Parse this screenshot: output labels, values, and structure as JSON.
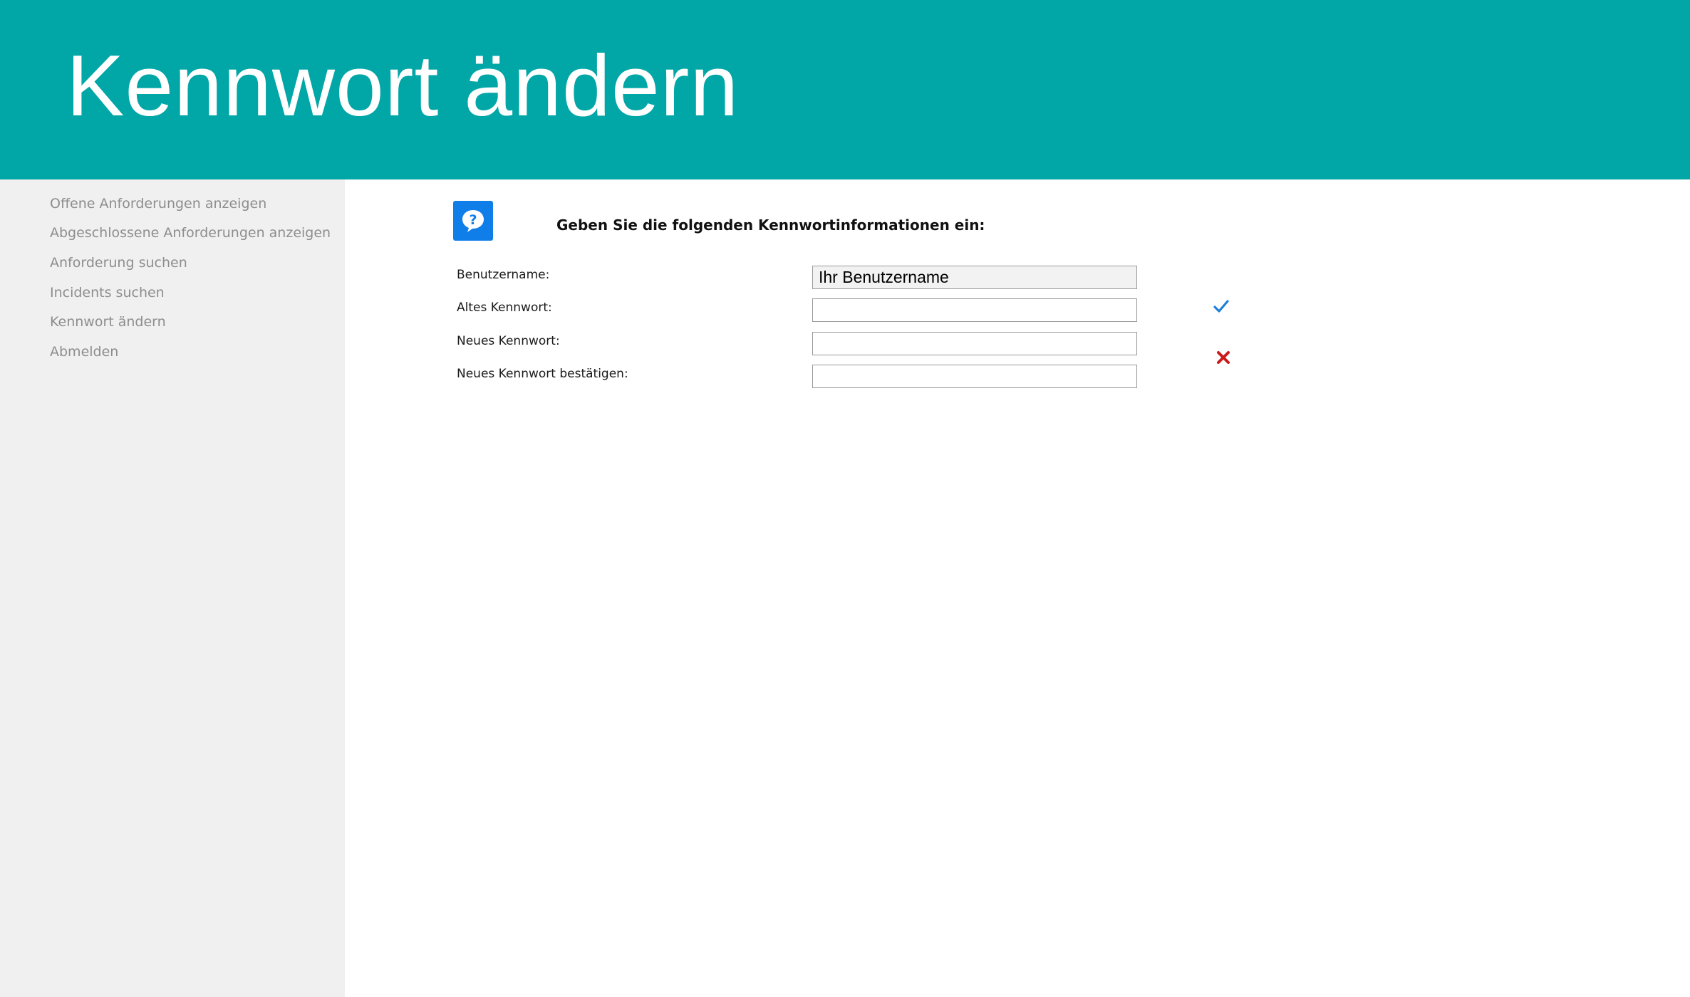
{
  "banner": {
    "title": "Kennwort ändern",
    "color": "#01a6a7"
  },
  "sidebar": {
    "items": [
      {
        "label": "Offene Anforderungen anzeigen"
      },
      {
        "label": "Abgeschlossene Anforderungen anzeigen"
      },
      {
        "label": "Anforderung suchen"
      },
      {
        "label": "Incidents suchen"
      },
      {
        "label": "Kennwort ändern"
      },
      {
        "label": "Abmelden"
      }
    ]
  },
  "form": {
    "help_icon": "help-question-icon",
    "heading": "Geben Sie die folgenden Kennwortinformationen ein:",
    "fields": [
      {
        "label": "Benutzername:",
        "value": "Ihr Benutzername",
        "readonly": true
      },
      {
        "label": "Altes Kennwort:",
        "value": ""
      },
      {
        "label": "Neues Kennwort:",
        "value": ""
      },
      {
        "label": "Neues Kennwort bestätigen:",
        "value": ""
      }
    ],
    "status_icons": [
      {
        "name": "checkmark-icon",
        "color": "#1f7fd8"
      },
      {
        "name": "cross-icon",
        "color": "#cc1a1a"
      }
    ]
  }
}
